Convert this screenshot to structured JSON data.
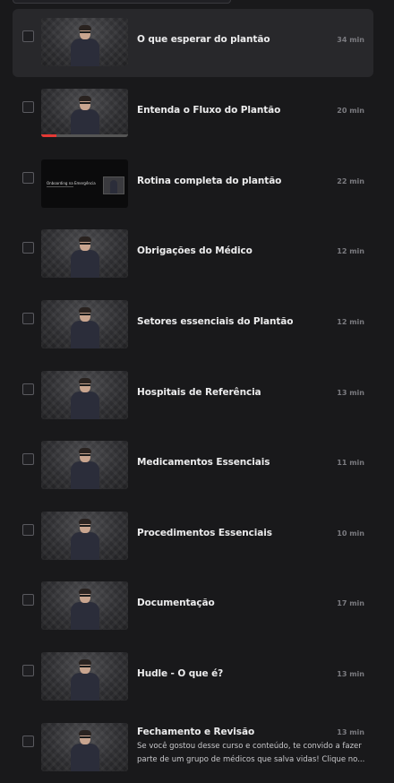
{
  "lessons": [
    {
      "title": "O que esperar do plantão",
      "duration": "34 min",
      "active": true
    },
    {
      "title": "Entenda o Fluxo do Plantão",
      "duration": "20 min",
      "progress": 0.18
    },
    {
      "title": "Rotina completa do plantão",
      "duration": "22 min",
      "slide_text": "Onboarding na Emergência"
    },
    {
      "title": "Obrigações do Médico",
      "duration": "12 min"
    },
    {
      "title": "Setores essenciais do Plantão",
      "duration": "12 min"
    },
    {
      "title": "Hospitais de Referência",
      "duration": "13 min"
    },
    {
      "title": "Medicamentos Essenciais",
      "duration": "11 min"
    },
    {
      "title": "Procedimentos Essenciais",
      "duration": "10 min"
    },
    {
      "title": "Documentação",
      "duration": "17 min"
    },
    {
      "title": "Hudle - O que é?",
      "duration": "13 min"
    },
    {
      "title": "Fechamento e Revisão",
      "duration": "13 min",
      "description": "Se você gostou desse curso e conteúdo, te convido a fazer parte de um grupo de médicos que salva vidas! Clique no..."
    }
  ],
  "colors": {
    "accent": "#e53935",
    "background": "#19191b",
    "active_row": "#28282b"
  }
}
